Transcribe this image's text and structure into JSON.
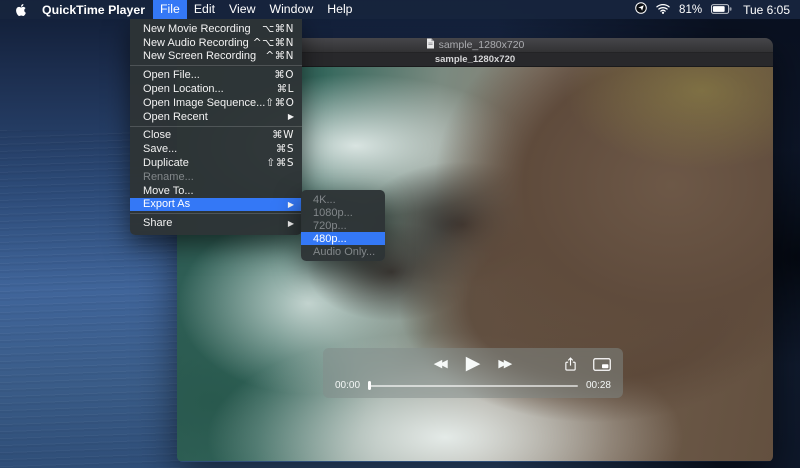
{
  "menu_bar": {
    "app_name": "QuickTime Player",
    "menus": [
      "File",
      "Edit",
      "View",
      "Window",
      "Help"
    ],
    "active_menu": "File",
    "status": {
      "battery_percent": "81%",
      "clock": "Tue 6:05"
    }
  },
  "file_menu": {
    "items": [
      {
        "label": "New Movie Recording",
        "shortcut": "⌥⌘N"
      },
      {
        "label": "New Audio Recording",
        "shortcut": "^⌥⌘N"
      },
      {
        "label": "New Screen Recording",
        "shortcut": "^⌘N"
      },
      {
        "label": "Open File...",
        "shortcut": "⌘O"
      },
      {
        "label": "Open Location...",
        "shortcut": "⌘L"
      },
      {
        "label": "Open Image Sequence...",
        "shortcut": "⇧⌘O"
      },
      {
        "label": "Open Recent"
      },
      {
        "label": "Close",
        "shortcut": "⌘W"
      },
      {
        "label": "Save...",
        "shortcut": "⌘S"
      },
      {
        "label": "Duplicate",
        "shortcut": "⇧⌘S"
      },
      {
        "label": "Rename..."
      },
      {
        "label": "Move To..."
      },
      {
        "label": "Export As"
      },
      {
        "label": "Share"
      }
    ]
  },
  "export_submenu": {
    "items": [
      {
        "label": "4K..."
      },
      {
        "label": "1080p..."
      },
      {
        "label": "720p..."
      },
      {
        "label": "480p..."
      },
      {
        "label": "Audio Only..."
      }
    ],
    "selected": "480p..."
  },
  "window": {
    "title": "sample_1280x720",
    "tab_title": "sample_1280x720"
  },
  "player": {
    "elapsed": "00:00",
    "remaining": "00:28"
  },
  "glyphs": {
    "submenu_arrow": "▶",
    "rewind": "◀◀",
    "play": "▶",
    "fast_forward": "▶▶"
  },
  "icons": {
    "apple": "apple-logo",
    "location": "location-arrow-in-circle",
    "wifi": "wifi-waves",
    "battery": "battery-level",
    "proxy_document": "document-page",
    "share": "square-with-up-arrow",
    "pip": "picture-in-picture-rect"
  },
  "colors": {
    "accent_blue": "#3478f6",
    "menu_panel": "#2d3436",
    "menubar_bg": "#17243d",
    "disabled_text": "#82878a",
    "window_chrome": "#323234"
  }
}
